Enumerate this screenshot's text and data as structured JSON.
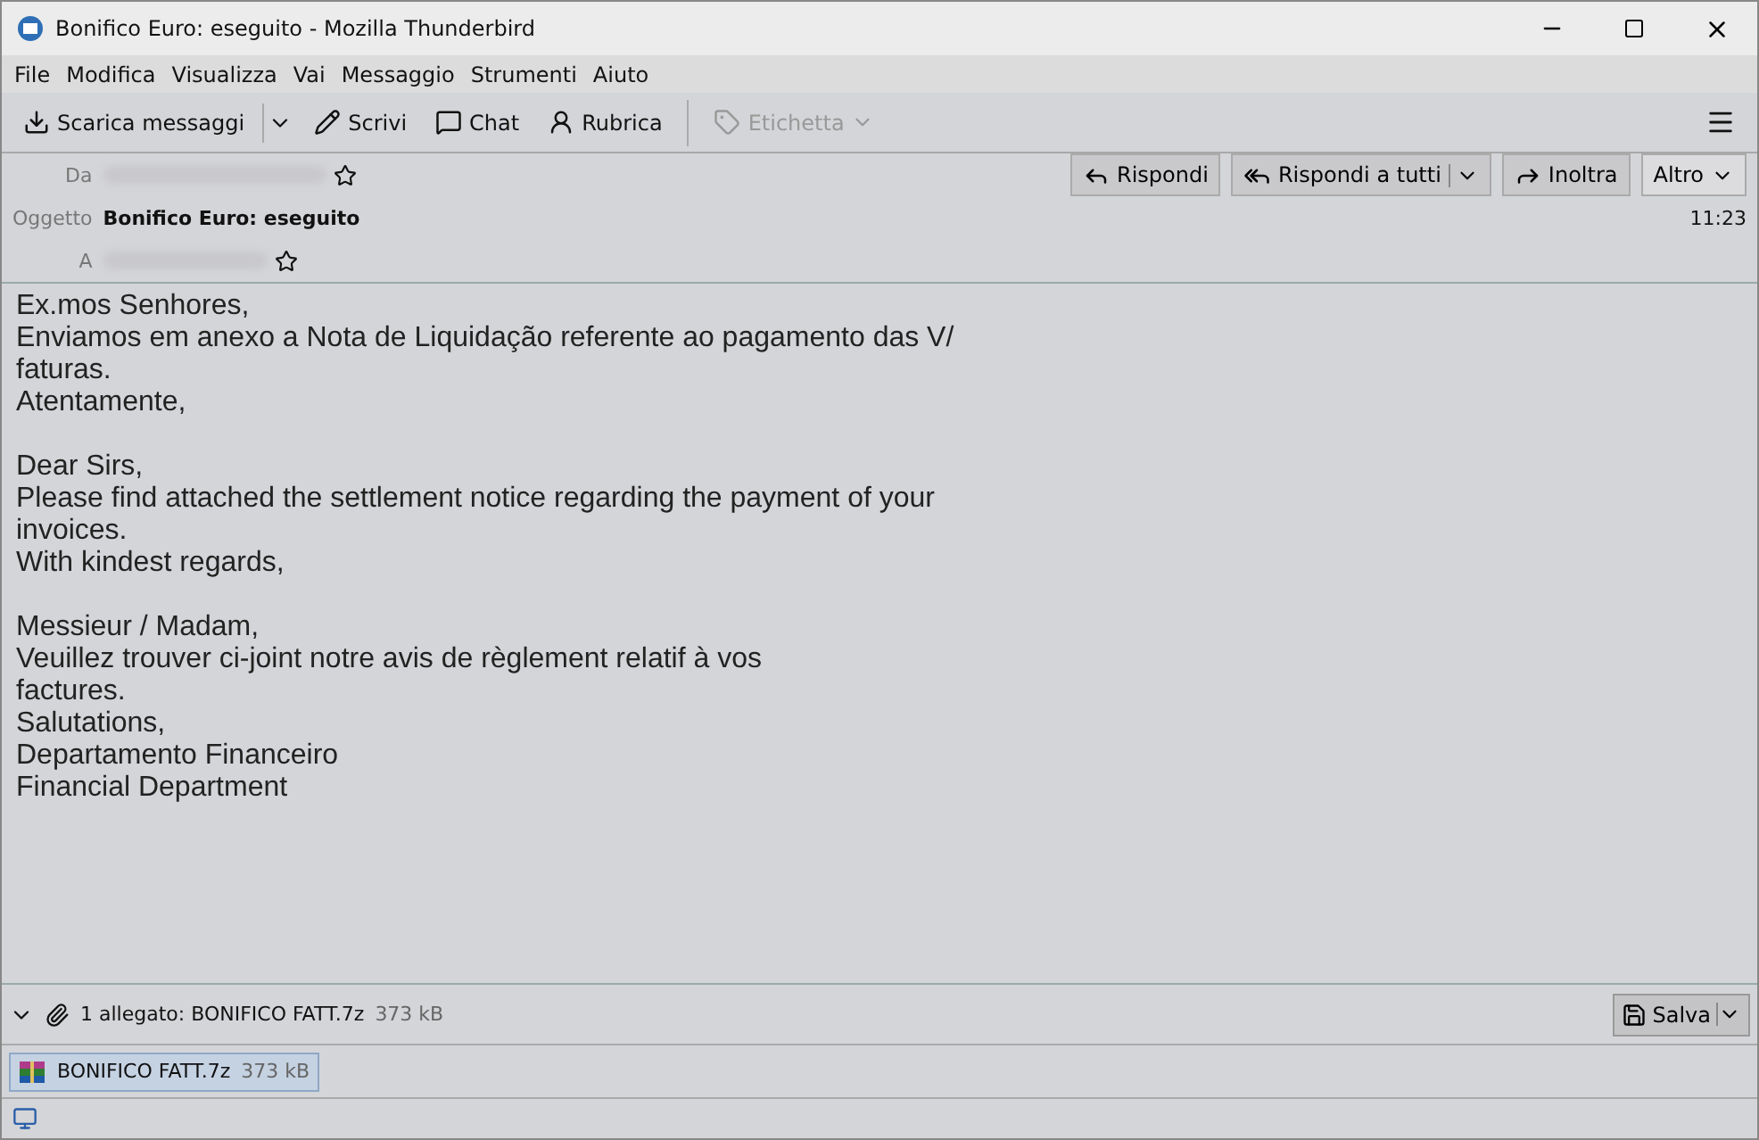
{
  "window": {
    "title": "Bonifico Euro: eseguito - Mozilla Thunderbird"
  },
  "menu": [
    "File",
    "Modifica",
    "Visualizza",
    "Vai",
    "Messaggio",
    "Strumenti",
    "Aiuto"
  ],
  "toolbar": [
    {
      "kind": "split",
      "label": "Scarica messaggi",
      "disabled": false
    },
    {
      "kind": "plain",
      "label": "Scrivi",
      "disabled": false
    },
    {
      "kind": "plain",
      "label": "Chat",
      "disabled": false
    },
    {
      "kind": "plain",
      "label": "Rubrica",
      "disabled": false
    },
    {
      "kind": "menu",
      "label": "Etichetta",
      "disabled": true
    }
  ],
  "header": {
    "from_label": "Da",
    "subject_label": "Oggetto",
    "subject": "Bonifico Euro: eseguito",
    "to_label": "A",
    "time": "11:23",
    "actions": [
      {
        "kind": "plain",
        "label": "Rispondi"
      },
      {
        "kind": "split",
        "label": "Rispondi a tutti"
      },
      {
        "kind": "plain",
        "label": "Inoltra"
      },
      {
        "kind": "menu",
        "label": "Altro"
      }
    ]
  },
  "body": [
    [
      "Ex.mos Senhores,",
      "Enviamos em anexo a Nota de Liquidação referente ao pagamento das V/",
      "faturas.",
      "Atentamente,"
    ],
    [
      "Dear Sirs,",
      "Please find attached the settlement notice regarding the payment of your",
      "invoices.",
      "With kindest regards,"
    ],
    [
      "Messieur / Madam,",
      "Veuillez trouver ci-joint notre avis de règlement relatif à vos",
      "factures.",
      "Salutations,",
      "Departamento Financeiro",
      "Financial Department"
    ]
  ],
  "attachment_bar": {
    "expanded": true,
    "summary": "1 allegato: BONIFICO FATT.7z",
    "size": "373 kB",
    "save": "Salva"
  },
  "attachments": [
    {
      "name": "BONIFICO FATT.7z",
      "size": "373 kB",
      "selected": true
    }
  ]
}
